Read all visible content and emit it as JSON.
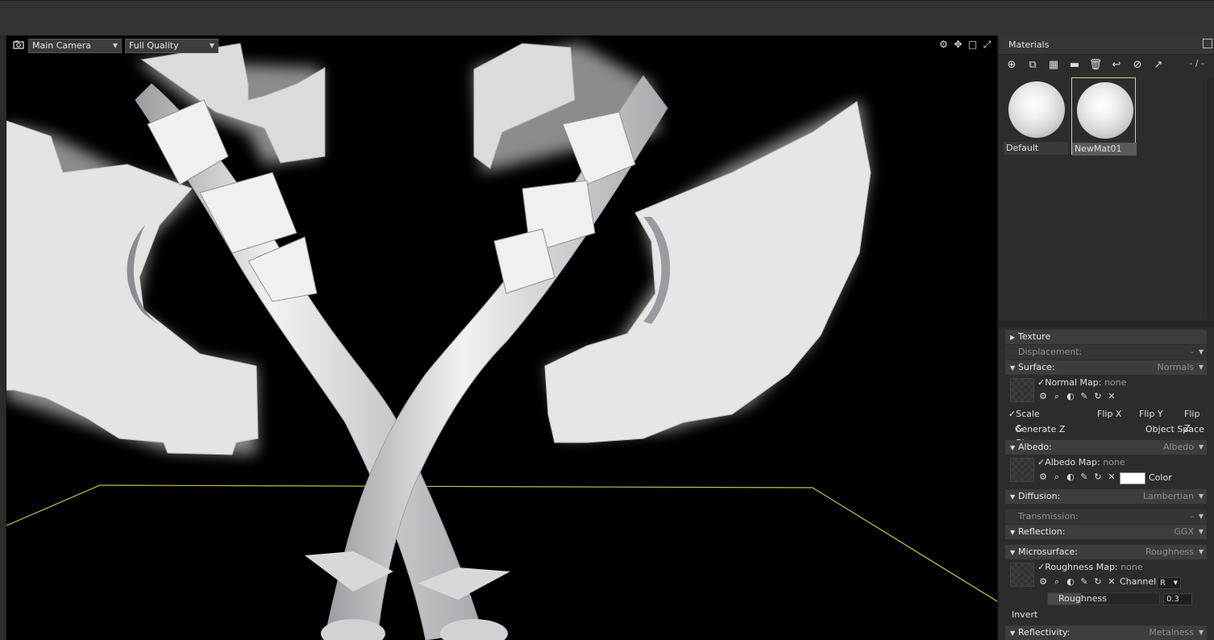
{
  "viewport": {
    "camera_select": "Main Camera",
    "quality_select": "Full Quality",
    "icons": [
      "gear-icon",
      "move-icon",
      "square-icon",
      "expand-icon"
    ]
  },
  "materials": {
    "title": "Materials",
    "count_label": "- / -",
    "toolbar_icons": [
      "add-icon",
      "duplicate-icon",
      "checker-icon",
      "folder-icon",
      "trash-icon",
      "apply-icon",
      "reset-icon",
      "export-icon"
    ],
    "items": [
      {
        "name": "Default",
        "selected": false
      },
      {
        "name": "NewMat01",
        "selected": true
      }
    ]
  },
  "properties": {
    "texture": "Texture",
    "displacement": {
      "label": "Displacement:",
      "value": "-"
    },
    "surface": {
      "label": "Surface:",
      "value": "Normals"
    },
    "normal_map": {
      "label": "Normal Map:",
      "value": "none"
    },
    "surface_opts": {
      "scale_bias": "Scale & Bias",
      "flip_x": "Flip X",
      "flip_y": "Flip Y",
      "flip_z": "Flip Z",
      "generate_z": "Generate Z",
      "object_space": "Object Space"
    },
    "albedo": {
      "label": "Albedo:",
      "value": "Albedo"
    },
    "albedo_map": {
      "label": "Albedo Map:",
      "value": "none",
      "color_label": "Color",
      "color": "#ffffff"
    },
    "diffusion": {
      "label": "Diffusion:",
      "value": "Lambertian"
    },
    "transmission": {
      "label": "Transmission:",
      "value": "-"
    },
    "reflection": {
      "label": "Reflection:",
      "value": "GGX"
    },
    "microsurface": {
      "label": "Microsurface:",
      "value": "Roughness"
    },
    "roughness_map": {
      "label": "Roughness Map:",
      "value": "none",
      "channel_label": "Channel",
      "channel": "R"
    },
    "roughness": {
      "label": "Roughness",
      "value": "0.3",
      "fraction": 0.3
    },
    "invert": "Invert",
    "reflectivity": {
      "label": "Reflectivity:",
      "value": "Metalness"
    }
  }
}
